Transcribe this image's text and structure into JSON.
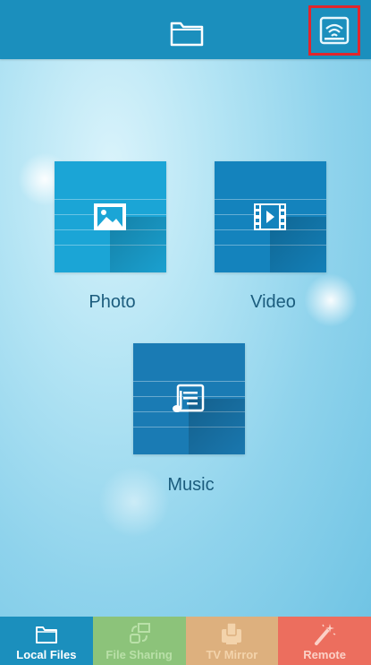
{
  "header": {
    "folder_icon": "folder-icon",
    "cast_icon": "wifi-cast-icon"
  },
  "tiles": [
    {
      "label": "Photo",
      "icon": "photo-icon",
      "color": "#1ba5d6"
    },
    {
      "label": "Video",
      "icon": "video-icon",
      "color": "#1483bd"
    },
    {
      "label": "Music",
      "icon": "music-icon",
      "color": "#1a7bb4"
    }
  ],
  "tabbar": {
    "tabs": [
      {
        "label": "Local Files",
        "icon": "folder-icon",
        "color": "#1b8fbd",
        "selected": true
      },
      {
        "label": "File Sharing",
        "icon": "share-icon",
        "color": "#8cc37a",
        "selected": false
      },
      {
        "label": "TV Mirror",
        "icon": "mirror-icon",
        "color": "#ddb07e",
        "selected": false
      },
      {
        "label": "Remote",
        "icon": "remote-wand-icon",
        "color": "#ec6e5e",
        "selected": false
      }
    ]
  },
  "colors": {
    "header": "#1b8fbd",
    "highlight_border": "#e1262c"
  }
}
